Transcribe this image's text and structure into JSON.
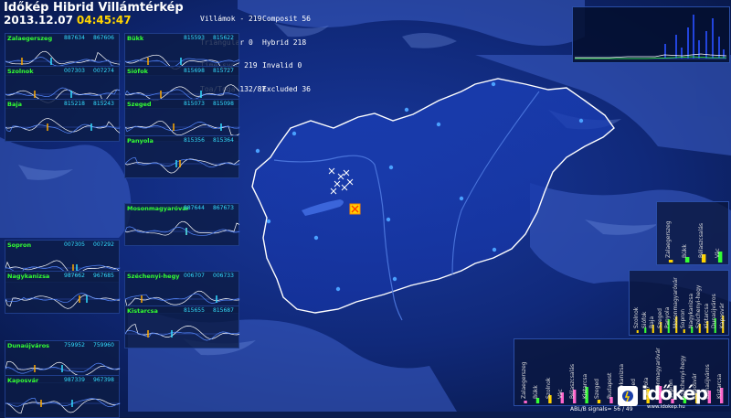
{
  "header": {
    "title": "Időkép Hibrid Villámtérkép",
    "date": "2013.12.07",
    "time": "04:45:47"
  },
  "stats": {
    "col1": [
      "Villámok - 219",
      "Triangular 0",
      "Time sync 219",
      "Toa/Toga 132/87"
    ],
    "col2": [
      "Composit 56",
      "Hybrid 218",
      "Invalid 0",
      "Excluded 36"
    ]
  },
  "stations": [
    {
      "name": "Zalaegerszeg",
      "code_a": "887634",
      "code_b": "867606"
    },
    {
      "name": "Bükk",
      "code_a": "815593",
      "code_b": "815622"
    },
    {
      "name": "Szolnok",
      "code_a": "007303",
      "code_b": "007274"
    },
    {
      "name": "Siófok",
      "code_a": "815698",
      "code_b": "815727"
    },
    {
      "name": "Baja",
      "code_a": "815218",
      "code_b": "815243"
    },
    {
      "name": "Szeged",
      "code_a": "815073",
      "code_b": "815098"
    },
    {
      "name": "Panyola",
      "code_a": "815356",
      "code_b": "815364"
    },
    {
      "name": "Mosonmagyaróvár",
      "code_a": "887644",
      "code_b": "867673"
    },
    {
      "name": "Sopron",
      "code_a": "007305",
      "code_b": "007292"
    },
    {
      "name": "Nagykanizsa",
      "code_a": "987662",
      "code_b": "967685"
    },
    {
      "name": "Széchenyi-hegy",
      "code_a": "006707",
      "code_b": "006733"
    },
    {
      "name": "Kistarcsa",
      "code_a": "815655",
      "code_b": "815687"
    },
    {
      "name": "Dunaújváros",
      "code_a": "759952",
      "code_b": "759960"
    },
    {
      "name": "Kaposvár",
      "code_a": "987339",
      "code_b": "967398"
    }
  ],
  "hist_right": {
    "labels": [
      "Zalaegerszeg",
      "Bükk",
      "Bélaszcsalás",
      "Vác"
    ]
  },
  "hist_mid": {
    "labels": [
      "Szolnok",
      "Siófok",
      "Baja",
      "Szeged",
      "Panyola",
      "Mosonmagyaróvár",
      "Sopron",
      "Nagykanizsa",
      "Széchenyi-hegy",
      "Kistarcsa",
      "Dunaújváros",
      "Kaposvár"
    ]
  },
  "hist_bottom": {
    "labels": [
      "Zalaegerszeg",
      "Bükk",
      "Szolnok",
      "Vác",
      "Bélaszcsalás",
      "Kistarcsa",
      "Szeged",
      "Budapest",
      "Nagykanizsa",
      "Szeged",
      "Panyola",
      "Mosonmagyaróvár",
      "Sopron",
      "Széchenyi-hegy",
      "Kaposvár",
      "Dunaújváros",
      "Kistarcsa"
    ]
  },
  "logo": {
    "text": "időkép",
    "sub": "www.idokep.hu"
  },
  "bottom_caption": "ABL/B signals= 56 / 49",
  "colors": {
    "station_name": "#33ff33",
    "station_code": "#33ddff",
    "border": "#ffffff",
    "time": "#ffd400"
  }
}
